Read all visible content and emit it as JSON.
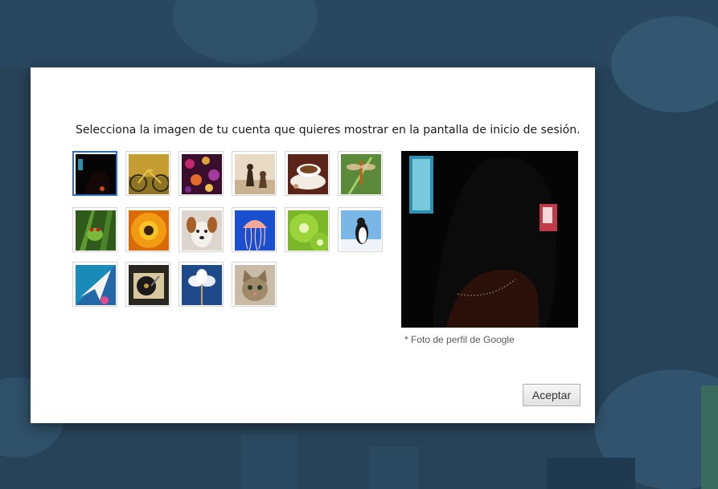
{
  "dialog": {
    "prompt": "Selecciona la imagen de tu cuenta que quieres mostrar en la pantalla de inicio de sesión.",
    "preview_caption": "* Foto de perfil de Google",
    "accept_label": "Aceptar"
  },
  "avatars": [
    {
      "icon": "google-profile-photo",
      "selected": true
    },
    {
      "icon": "bicycle"
    },
    {
      "icon": "bokeh-lights"
    },
    {
      "icon": "chess-pieces"
    },
    {
      "icon": "coffee-cup"
    },
    {
      "icon": "dragonfly"
    },
    {
      "icon": "frog"
    },
    {
      "icon": "orange-flower"
    },
    {
      "icon": "puppy"
    },
    {
      "icon": "jellyfish"
    },
    {
      "icon": "kiwi"
    },
    {
      "icon": "penguin"
    },
    {
      "icon": "paper-plane"
    },
    {
      "icon": "record-player"
    },
    {
      "icon": "white-flower"
    },
    {
      "icon": "kitten"
    }
  ],
  "colors": {
    "selected_border": "#2d6fc1",
    "background": "#27435a"
  }
}
